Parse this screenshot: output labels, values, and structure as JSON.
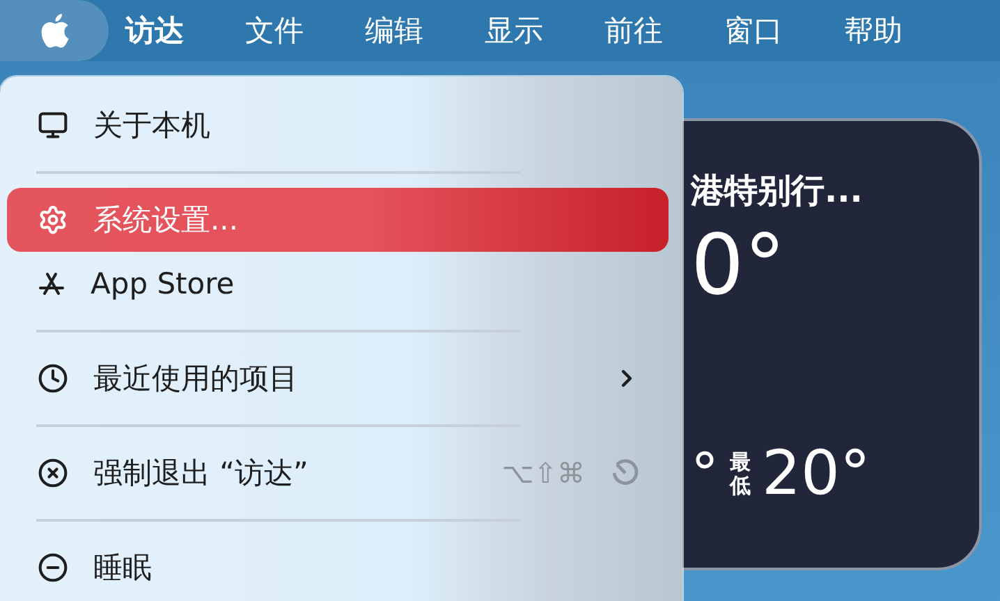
{
  "menu_bar": {
    "apple_menu": {
      "open": true
    },
    "items": [
      {
        "label": "访达",
        "kind": "app"
      },
      {
        "label": "文件",
        "kind": "menu"
      },
      {
        "label": "编辑",
        "kind": "menu"
      },
      {
        "label": "显示",
        "kind": "menu"
      },
      {
        "label": "前往",
        "kind": "menu"
      },
      {
        "label": "窗口",
        "kind": "menu"
      },
      {
        "label": "帮助",
        "kind": "menu"
      }
    ]
  },
  "apple_menu": {
    "items": [
      {
        "kind": "item",
        "label": "关于本机",
        "selected": false,
        "submenu": false
      },
      {
        "kind": "separator"
      },
      {
        "kind": "item",
        "label": "系统设置...",
        "selected": true,
        "submenu": false
      },
      {
        "kind": "item",
        "label": "App Store",
        "selected": false,
        "submenu": false
      },
      {
        "kind": "separator"
      },
      {
        "kind": "item",
        "label": "最近使用的项目",
        "selected": false,
        "submenu": true
      },
      {
        "kind": "separator"
      },
      {
        "kind": "item",
        "label": "强制退出 “访达”",
        "selected": false,
        "submenu": false,
        "shortcut": "⌥⇧⌘"
      },
      {
        "kind": "separator"
      },
      {
        "kind": "item",
        "label": "睡眠",
        "selected": false,
        "submenu": false
      }
    ]
  },
  "weather_widget": {
    "location": "港特别行...",
    "temperature": "0°",
    "high": "°",
    "low_label": "最低",
    "low": "20°"
  }
}
